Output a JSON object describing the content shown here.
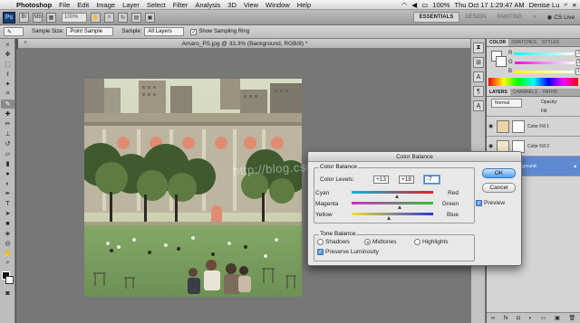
{
  "menubar": {
    "items": [
      "Photoshop",
      "File",
      "Edit",
      "Image",
      "Layer",
      "Select",
      "Filter",
      "Analysis",
      "3D",
      "View",
      "Window",
      "Help"
    ],
    "battery": "100%",
    "datetime": "Thu Oct 17  1:29:47 AM",
    "user": "Denise Lu"
  },
  "appbar": {
    "logo": "Ps",
    "zoom": "100%",
    "workspaces": [
      "ESSENTIALS",
      "DESIGN",
      "PAINTING"
    ],
    "workspace_more": "»",
    "cslive": "CS Live"
  },
  "options": {
    "sample_size_label": "Sample Size:",
    "sample_size_value": "Point Sample",
    "sample_label": "Sample:",
    "sample_value": "All Layers",
    "show_ring_label": "Show Sampling Ring"
  },
  "document": {
    "tab_title": "Amaro_PS.jpg @ 33.3% (Background, RGB/8) *",
    "watermark": "http://blog.csdn.net/"
  },
  "right_panels": {
    "color_tabs": [
      "COLOR",
      "SWATCHES",
      "STYLES"
    ],
    "rgb_labels": [
      "R",
      "G",
      "B"
    ],
    "rgb_values": [
      "255",
      "255",
      "255"
    ],
    "layers_tabs": [
      "LAYERS",
      "CHANNELS",
      "PATHS"
    ],
    "blend_mode": "Normal",
    "opacity_label": "Opacity:",
    "fill_label": "Fill:",
    "layers": [
      "Color Fill 1",
      "Color Fill 2",
      "Background"
    ]
  },
  "dialog": {
    "title": "Color Balance",
    "group_color": "Color Balance",
    "color_levels_label": "Color Levels:",
    "levels": [
      "+13",
      "+18",
      "-7"
    ],
    "rows": [
      {
        "left": "Cyan",
        "right": "Red",
        "value": 13
      },
      {
        "left": "Magenta",
        "right": "Green",
        "value": 18
      },
      {
        "left": "Yellow",
        "right": "Blue",
        "value": -7
      }
    ],
    "group_tone": "Tone Balance",
    "tones": [
      "Shadows",
      "Midtones",
      "Highlights"
    ],
    "selected_tone": "Midtones",
    "preserve_label": "Preserve Luminosity",
    "ok": "OK",
    "cancel": "Cancel",
    "preview": "Preview",
    "colors": {
      "ok_blue": "#4f9ef5"
    }
  }
}
